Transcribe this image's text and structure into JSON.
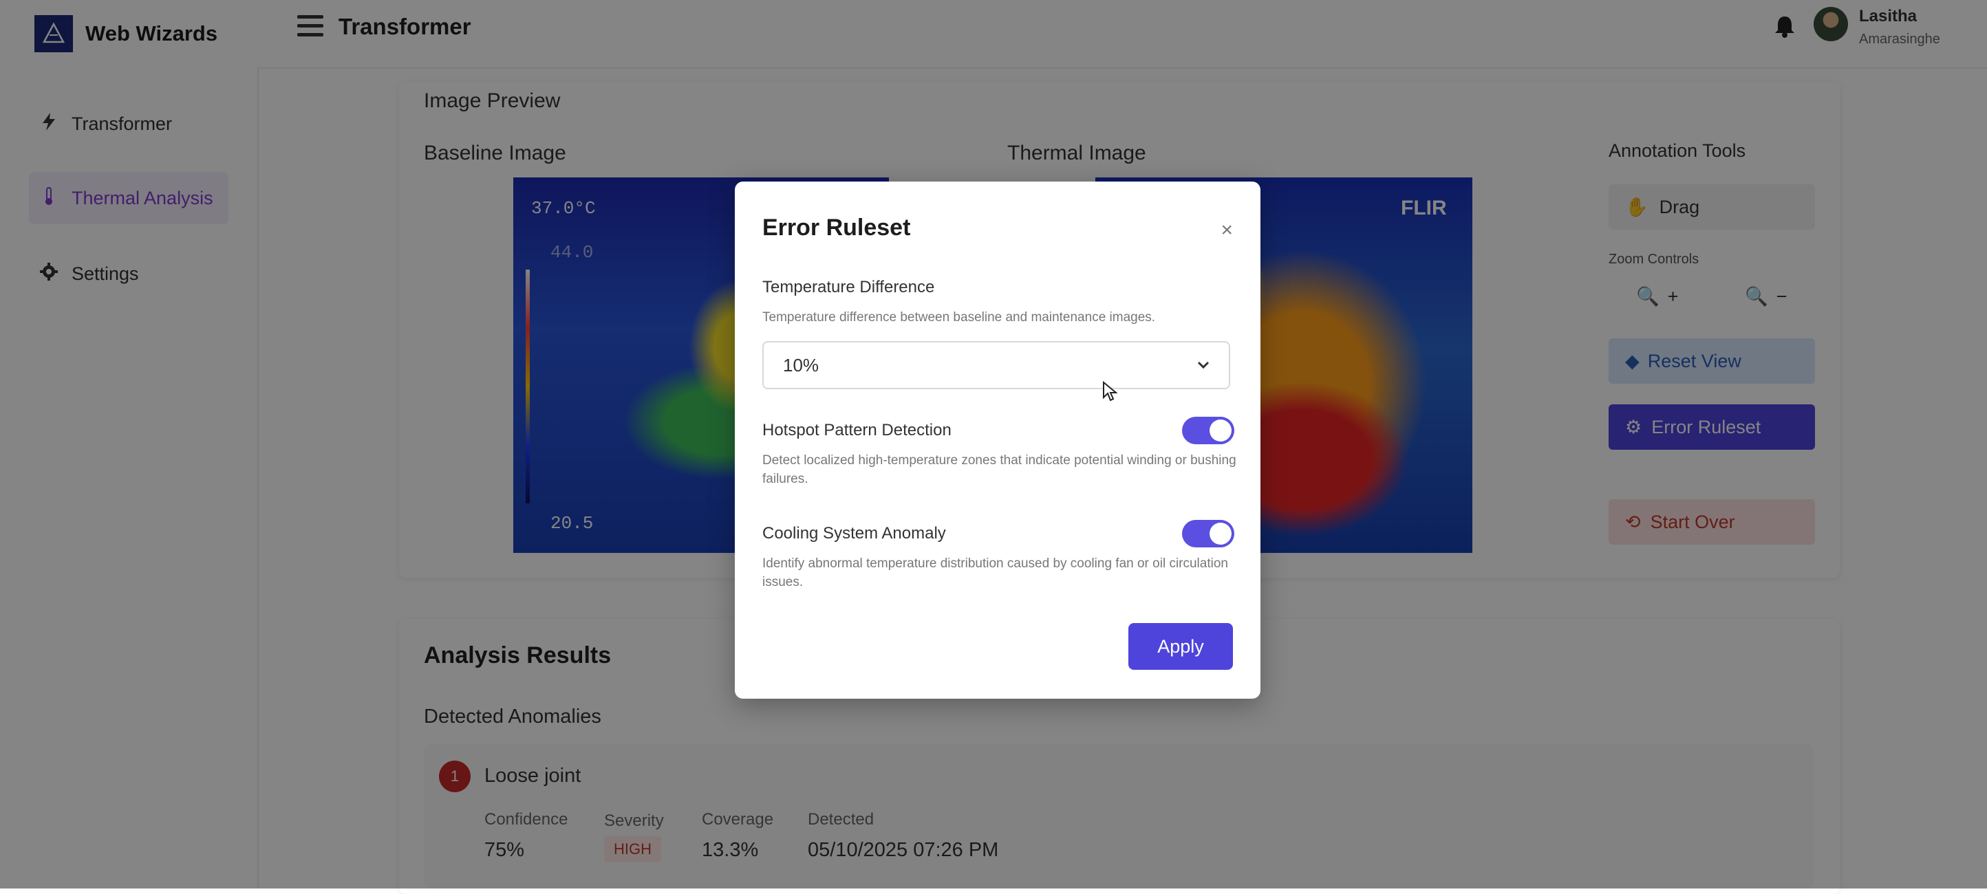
{
  "brand": {
    "name": "Web Wizards"
  },
  "sidebar": {
    "items": [
      {
        "label": "Transformer",
        "icon": "bolt-icon",
        "active": false
      },
      {
        "label": "Thermal Analysis",
        "icon": "thermometer-icon",
        "active": true
      },
      {
        "label": "Settings",
        "icon": "gear-icon",
        "active": false
      }
    ]
  },
  "header": {
    "title": "Transformer",
    "user_first": "Lasitha",
    "user_last": "Amarasinghe"
  },
  "preview": {
    "section_title": "Image Preview",
    "baseline_title": "Baseline Image",
    "thermal_title": "Thermal Image",
    "baseline_temp": "37.0°C",
    "baseline_max": "44.0",
    "baseline_min": "20.5",
    "thermal_brand": "FLIR"
  },
  "tools": {
    "title": "Annotation Tools",
    "drag_label": "Drag",
    "zoom_label": "Zoom Controls",
    "zoom_in": "+",
    "zoom_out": "−",
    "reset_view": "Reset View",
    "error_ruleset": "Error Ruleset",
    "start_over": "Start Over"
  },
  "results": {
    "title": "Analysis Results",
    "subtitle": "Detected Anomalies",
    "anomaly": {
      "index": "1",
      "name": "Loose joint",
      "confidence_label": "Confidence",
      "confidence": "75%",
      "severity_label": "Severity",
      "severity": "HIGH",
      "coverage_label": "Coverage",
      "coverage": "13.3%",
      "detected_label": "Detected",
      "detected": "05/10/2025 07:26 PM"
    }
  },
  "modal": {
    "title": "Error Ruleset",
    "close": "×",
    "temp_label": "Temperature Difference",
    "temp_desc": "Temperature difference between baseline and maintenance images.",
    "temp_value": "10%",
    "hotspot_label": "Hotspot Pattern Detection",
    "hotspot_desc": "Detect localized high-temperature zones that indicate potential winding or bushing failures.",
    "hotspot_on": true,
    "cooling_label": "Cooling System Anomaly",
    "cooling_desc": "Identify abnormal temperature distribution caused by cooling fan or oil circulation issues.",
    "cooling_on": true,
    "apply": "Apply"
  },
  "colors": {
    "accent": "#4e44dc",
    "sidebar_active": "#7d3ccf",
    "severity_high": "#c0392b"
  }
}
